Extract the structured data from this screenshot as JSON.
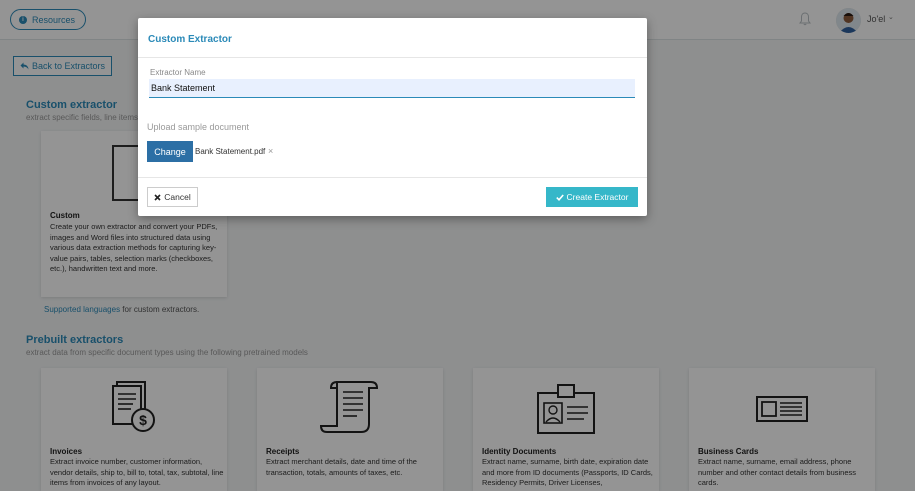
{
  "header": {
    "resources_label": "Resources",
    "user_name": "Jo'el",
    "caret": "⌄"
  },
  "page": {
    "back_label": "Back to Extractors",
    "custom_section": {
      "title": "Custom extractor",
      "subtitle": "extract specific fields, line items"
    },
    "custom_card": {
      "title": "Custom",
      "description": "Create your own extractor and convert your PDFs, images and Word files into structured data using various data extraction methods for capturing key-value pairs, tables, selection marks (checkboxes, etc.), handwritten text and more."
    },
    "supported": {
      "link": "Supported languages",
      "suffix": " for custom extractors."
    },
    "prebuilt_section": {
      "title": "Prebuilt extractors",
      "subtitle": "extract data from specific document types using the following pretrained models"
    },
    "prebuilt_cards": [
      {
        "title": "Invoices",
        "description": "Extract invoice number, customer information, vendor details, ship to, bill to, total, tax, subtotal, line items from invoices of any layout."
      },
      {
        "title": "Receipts",
        "description": "Extract merchant details, date and time of the transaction, totals, amounts of taxes, etc."
      },
      {
        "title": "Identity Documents",
        "description": "Extract name, surname, birth date, expiration date and more from ID documents (Passports, ID Cards, Residency Permits, Driver Licenses,"
      },
      {
        "title": "Business Cards",
        "description": "Extract name, surname, email address, phone number and other contact details from business cards."
      }
    ]
  },
  "modal": {
    "title": "Custom Extractor",
    "name_label": "Extractor Name",
    "name_value": "Bank Statement",
    "upload_label": "Upload sample document",
    "change_label": "Change",
    "file_name": "Bank Statement.pdf",
    "remove_glyph": "×",
    "cancel_label": "Cancel",
    "create_label": "Create Extractor"
  },
  "colors": {
    "accent": "#2b8ab8",
    "primary_button": "#2c6fa5",
    "create_button": "#35b7c9"
  }
}
